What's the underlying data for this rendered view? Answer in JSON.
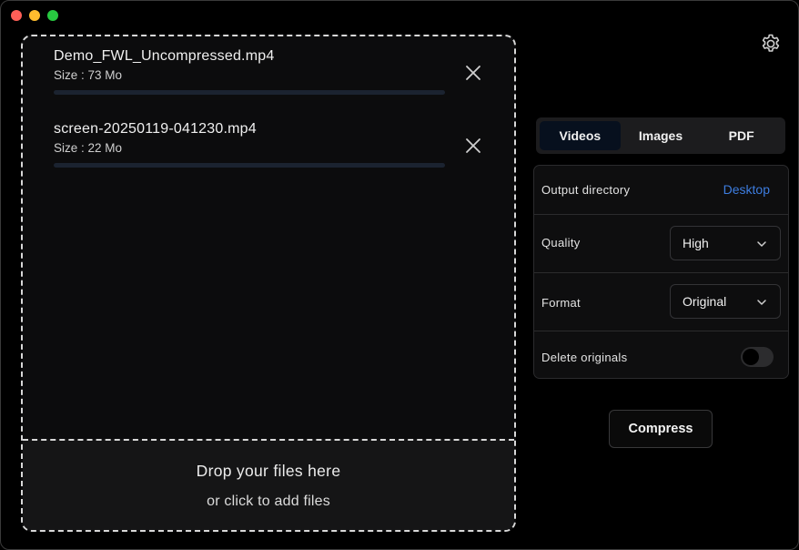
{
  "window": {
    "controls": [
      "close",
      "minimize",
      "maximize"
    ]
  },
  "files": [
    {
      "name": "Demo_FWL_Uncompressed.mp4",
      "size": "Size : 73 Mo",
      "progress": 0
    },
    {
      "name": "screen-20250119-041230.mp4",
      "size": "Size : 22 Mo",
      "progress": 0
    }
  ],
  "drop_zone": {
    "title": "Drop your files here",
    "subtitle": "or click to add files"
  },
  "tabs": [
    {
      "label": "Videos",
      "active": true
    },
    {
      "label": "Images",
      "active": false
    },
    {
      "label": "PDF",
      "active": false
    }
  ],
  "settings": {
    "output_directory": {
      "label": "Output directory",
      "value": "Desktop"
    },
    "quality": {
      "label": "Quality",
      "value": "High"
    },
    "format": {
      "label": "Format",
      "value": "Original"
    },
    "delete_originals": {
      "label": "Delete originals",
      "enabled": false
    }
  },
  "actions": {
    "compress_label": "Compress"
  },
  "icons": {
    "settings": "gear-icon",
    "remove": "close-icon",
    "dropdown": "chevron-down-icon"
  },
  "colors": {
    "link": "#3d7de0",
    "progress_track": "#1b2330",
    "traffic_close": "#fe5f57",
    "traffic_min": "#febc2e",
    "traffic_max": "#28c840"
  }
}
